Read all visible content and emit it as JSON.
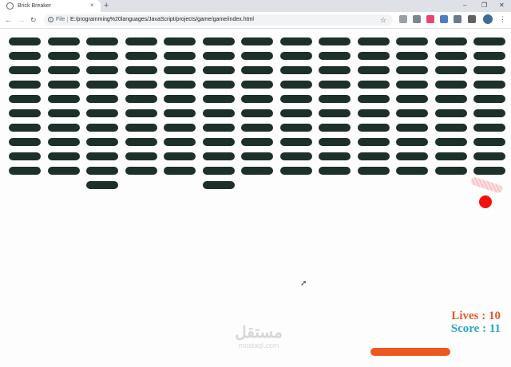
{
  "browser": {
    "tab_title": "Brick Breaker",
    "tab_close": "×",
    "new_tab": "+",
    "url_scheme_label": "File",
    "url": "E:/programming%20languages/JavaScript/projects/game/game/index.html",
    "window_controls": {
      "minimize": "–",
      "maximize": "❐",
      "close": "✕"
    },
    "nav": {
      "back": "←",
      "forward": "→",
      "reload": "↻"
    },
    "star": "☆",
    "menu": "⋮"
  },
  "game": {
    "bricks_full_columns": 13,
    "bricks_full_rows": 10,
    "extra_bricks_row11_columns": [
      3,
      6
    ],
    "brick_color": "#1d3029",
    "ball_color": "#f50f0f",
    "paddle_color": "#ee5720",
    "lives_label": "Lives : 10",
    "score_label": "Score : 11",
    "lives_color": "#e8592a",
    "score_color": "#2aa5d2"
  },
  "watermark": {
    "logo": "مستقل",
    "sub": "mostaql.com"
  }
}
